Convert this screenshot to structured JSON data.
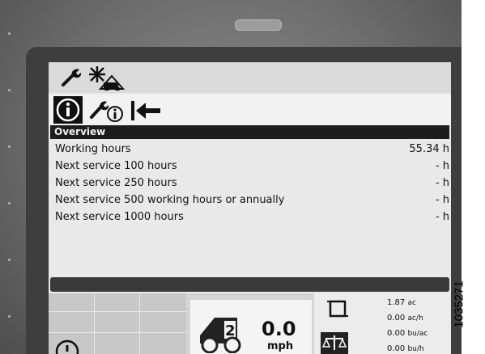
{
  "figure_id": "1035271",
  "tabs": {
    "top_icons": [
      "wrench-icon",
      "machine-settings-icon"
    ],
    "nav_icons": [
      "info-icon",
      "service-info-icon",
      "back-arrow-icon"
    ]
  },
  "overview": {
    "title": "Overview",
    "rows": [
      {
        "label": "Working hours",
        "value": "55.34 h"
      },
      {
        "label": "Next service 100 hours",
        "value": "- h"
      },
      {
        "label": "Next service 250 hours",
        "value": "- h"
      },
      {
        "label": "Next service 500 working hours or annually",
        "value": "- h"
      },
      {
        "label": "Next service 1000 hours",
        "value": "- h"
      }
    ]
  },
  "status": {
    "gear": "2",
    "speed_value": "0.0",
    "speed_unit": "mph",
    "rates": [
      {
        "value": "1.87",
        "unit": "ac"
      },
      {
        "value": "0.00",
        "unit": "ac/h"
      },
      {
        "value": "0.00",
        "unit": "bu/ac"
      },
      {
        "value": "0.00",
        "unit": "bu/h"
      }
    ]
  },
  "colors": {
    "screen_bg": "#e9e9e9",
    "header_bg": "#1d1d1d",
    "header_text": "#f2f2f2",
    "bezel": "#3e3e3e"
  }
}
